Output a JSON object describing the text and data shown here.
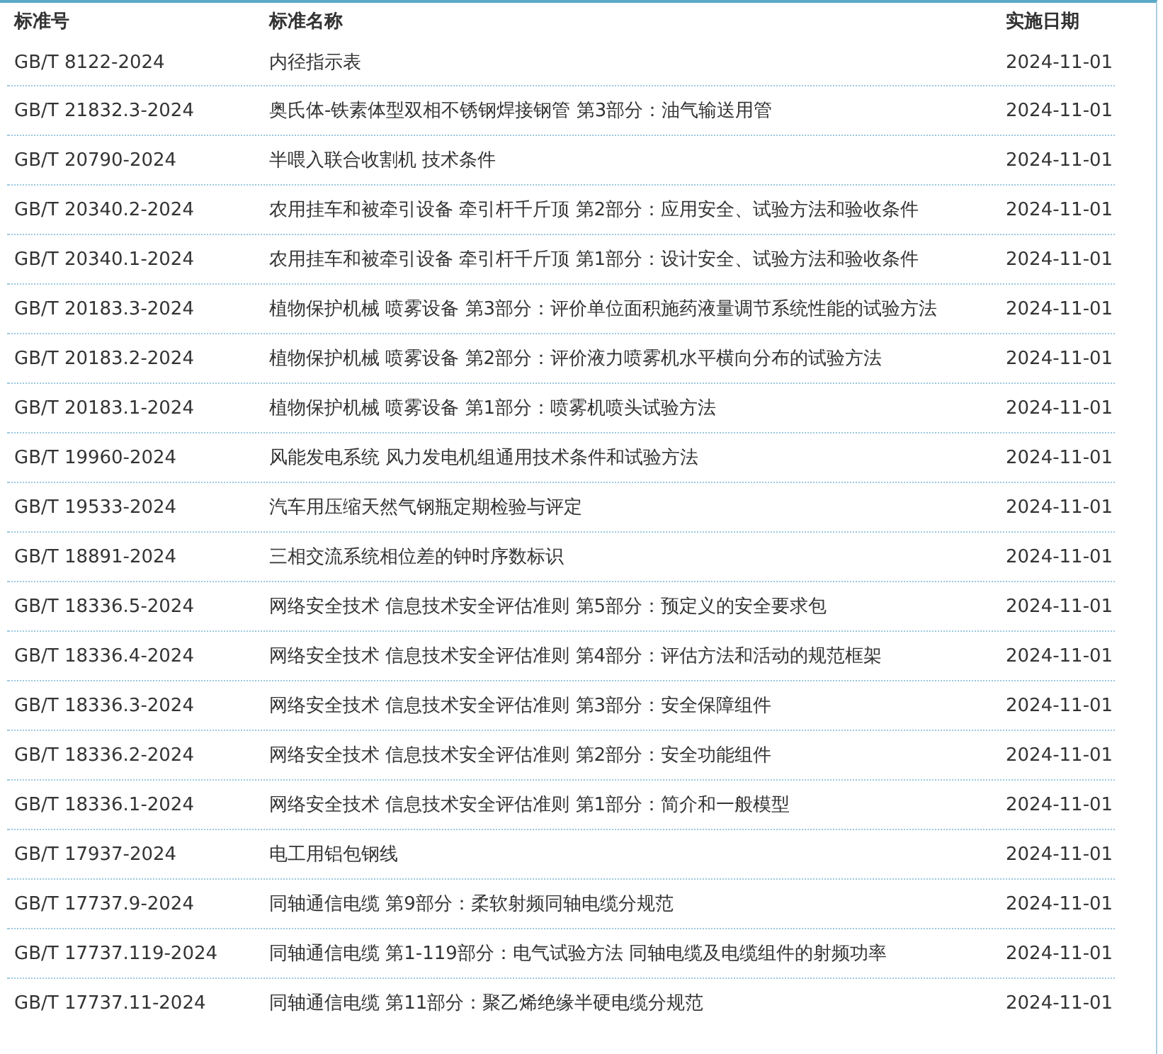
{
  "table": {
    "columns": [
      "标准号",
      "标准名称",
      "实施日期"
    ],
    "rows": [
      {
        "code": "GB/T 8122-2024",
        "name": "内径指示表",
        "date": "2024-11-01"
      },
      {
        "code": "GB/T 21832.3-2024",
        "name": "奥氏体-铁素体型双相不锈钢焊接钢管 第3部分：油气输送用管",
        "date": "2024-11-01"
      },
      {
        "code": "GB/T 20790-2024",
        "name": "半喂入联合收割机 技术条件",
        "date": "2024-11-01"
      },
      {
        "code": "GB/T 20340.2-2024",
        "name": "农用挂车和被牵引设备 牵引杆千斤顶 第2部分：应用安全、试验方法和验收条件",
        "date": "2024-11-01"
      },
      {
        "code": "GB/T 20340.1-2024",
        "name": "农用挂车和被牵引设备 牵引杆千斤顶 第1部分：设计安全、试验方法和验收条件",
        "date": "2024-11-01"
      },
      {
        "code": "GB/T 20183.3-2024",
        "name": "植物保护机械 喷雾设备 第3部分：评价单位面积施药液量调节系统性能的试验方法",
        "date": "2024-11-01"
      },
      {
        "code": "GB/T 20183.2-2024",
        "name": "植物保护机械 喷雾设备 第2部分：评价液力喷雾机水平横向分布的试验方法",
        "date": "2024-11-01"
      },
      {
        "code": "GB/T 20183.1-2024",
        "name": "植物保护机械 喷雾设备 第1部分：喷雾机喷头试验方法",
        "date": "2024-11-01"
      },
      {
        "code": "GB/T 19960-2024",
        "name": "风能发电系统 风力发电机组通用技术条件和试验方法",
        "date": "2024-11-01"
      },
      {
        "code": "GB/T 19533-2024",
        "name": "汽车用压缩天然气钢瓶定期检验与评定",
        "date": "2024-11-01"
      },
      {
        "code": "GB/T 18891-2024",
        "name": "三相交流系统相位差的钟时序数标识",
        "date": "2024-11-01"
      },
      {
        "code": "GB/T 18336.5-2024",
        "name": "网络安全技术 信息技术安全评估准则 第5部分：预定义的安全要求包",
        "date": "2024-11-01"
      },
      {
        "code": "GB/T 18336.4-2024",
        "name": "网络安全技术 信息技术安全评估准则 第4部分：评估方法和活动的规范框架",
        "date": "2024-11-01"
      },
      {
        "code": "GB/T 18336.3-2024",
        "name": "网络安全技术 信息技术安全评估准则 第3部分：安全保障组件",
        "date": "2024-11-01"
      },
      {
        "code": "GB/T 18336.2-2024",
        "name": "网络安全技术 信息技术安全评估准则 第2部分：安全功能组件",
        "date": "2024-11-01"
      },
      {
        "code": "GB/T 18336.1-2024",
        "name": "网络安全技术 信息技术安全评估准则 第1部分：简介和一般模型",
        "date": "2024-11-01"
      },
      {
        "code": "GB/T 17937-2024",
        "name": "电工用铝包钢线",
        "date": "2024-11-01"
      },
      {
        "code": "GB/T 17737.9-2024",
        "name": "同轴通信电缆 第9部分：柔软射频同轴电缆分规范",
        "date": "2024-11-01"
      },
      {
        "code": "GB/T 17737.119-2024",
        "name": "同轴通信电缆 第1-119部分：电气试验方法 同轴电缆及电缆组件的射频功率",
        "date": "2024-11-01"
      },
      {
        "code": "GB/T 17737.11-2024",
        "name": "同轴通信电缆 第11部分：聚乙烯绝缘半硬电缆分规范",
        "date": "2024-11-01"
      }
    ]
  }
}
